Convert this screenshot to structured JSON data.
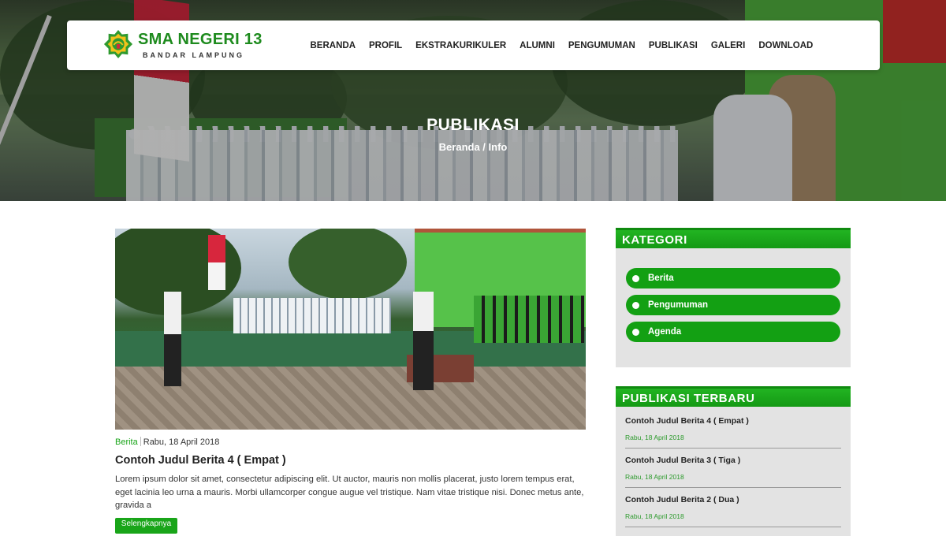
{
  "brand": {
    "title": "SMA NEGERI 13",
    "subtitle": "BANDAR LAMPUNG",
    "accent": "#19a519"
  },
  "nav": {
    "items": [
      "BERANDA",
      "PROFIL",
      "EKSTRAKURIKULER",
      "ALUMNI",
      "PENGUMUMAN",
      "PUBLIKASI",
      "GALERI",
      "DOWNLOAD"
    ]
  },
  "hero": {
    "title": "PUBLIKASI",
    "breadcrumb": "Beranda / Info"
  },
  "post": {
    "category": "Berita",
    "date": "Rabu, 18 April 2018",
    "title": "Contoh Judul Berita 4 ( Empat )",
    "excerpt": "Lorem ipsum dolor sit amet, consectetur adipiscing elit. Ut auctor, mauris non mollis placerat, justo lorem tempus erat, eget lacinia leo urna a mauris. Morbi ullamcorper congue augue vel tristique. Nam vitae tristique nisi. Donec metus ante, gravida a",
    "read_more": "Selengkapnya"
  },
  "sidebar": {
    "categories_title": "KATEGORI",
    "categories": [
      "Berita",
      "Pengumuman",
      "Agenda"
    ],
    "recent_title": "PUBLIKASI TERBARU",
    "recent": [
      {
        "title": "Contoh Judul Berita 4 ( Empat )",
        "date": "Rabu, 18 April 2018"
      },
      {
        "title": "Contoh Judul Berita 3 ( Tiga )",
        "date": "Rabu, 18 April 2018"
      },
      {
        "title": "Contoh Judul Berita 2 ( Dua )",
        "date": "Rabu, 18 April 2018"
      }
    ]
  }
}
